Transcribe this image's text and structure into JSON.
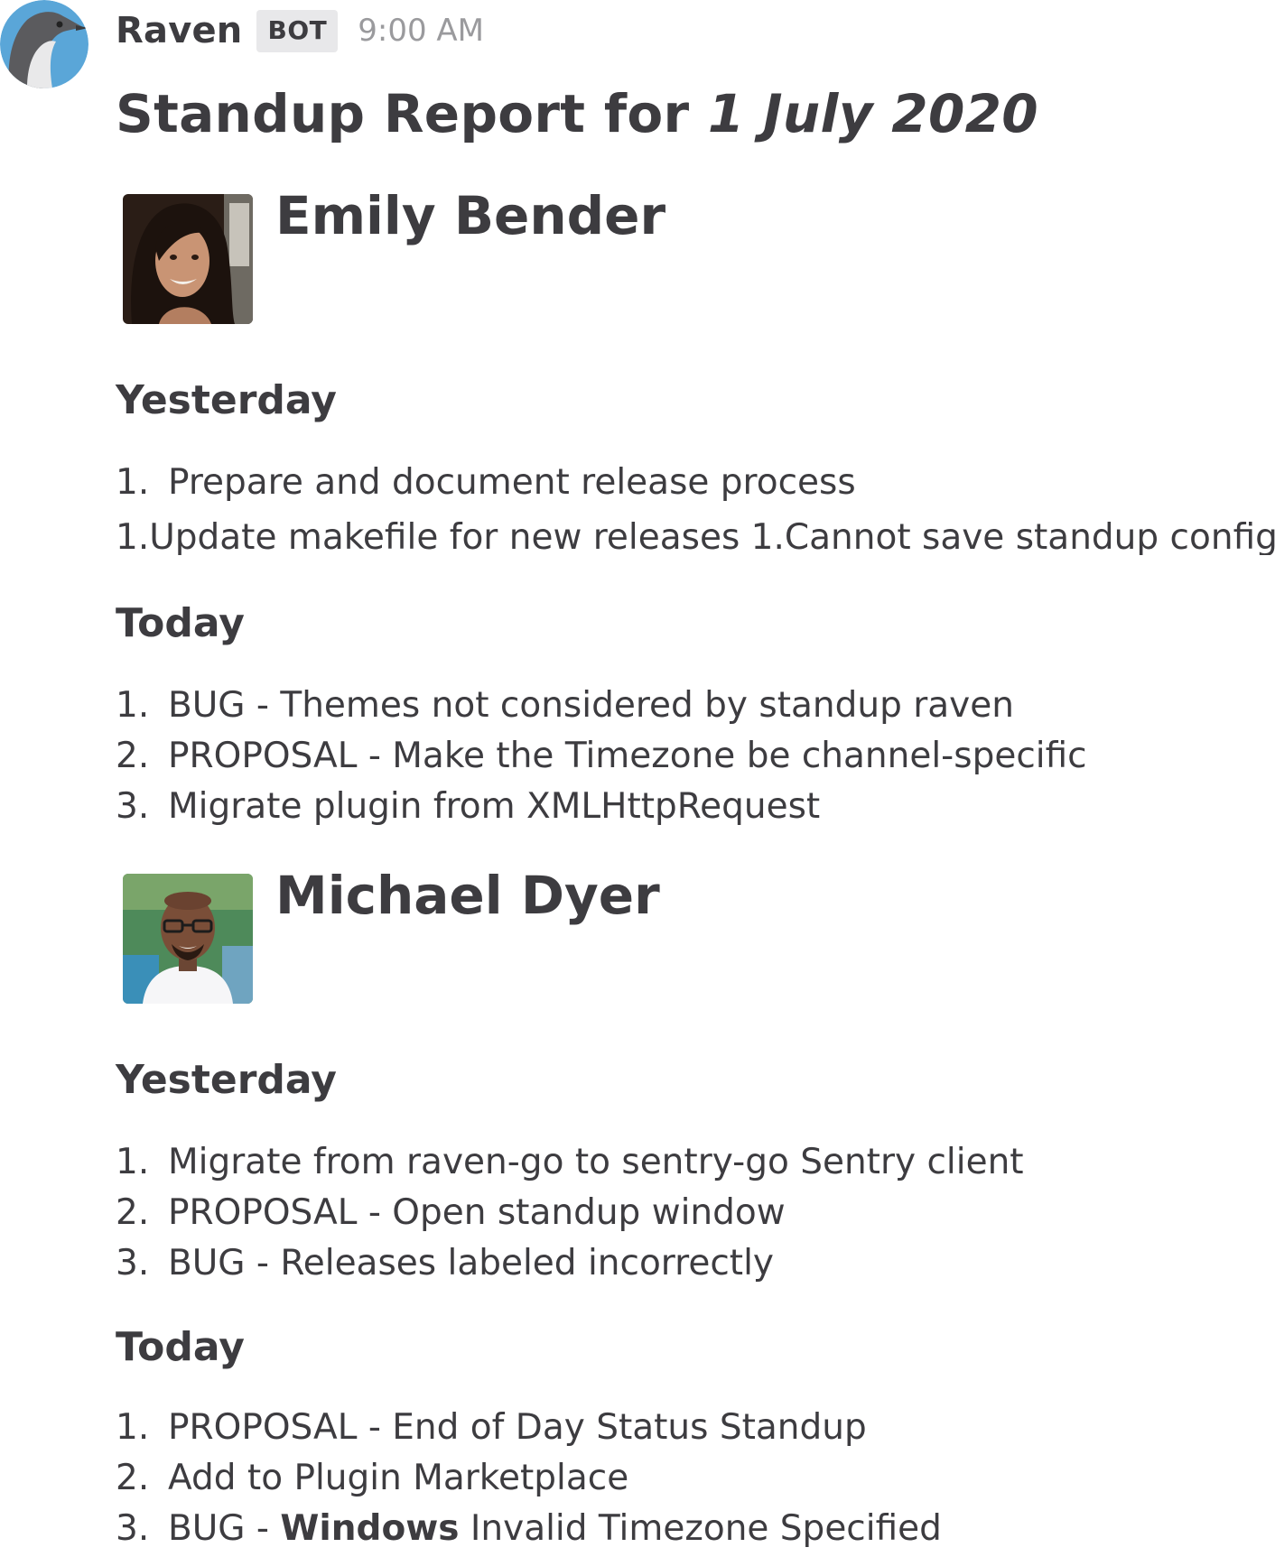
{
  "message": {
    "username": "Raven",
    "badge": "BOT",
    "time": "9:00 AM",
    "avatar_icon": "raven-bird-icon"
  },
  "report": {
    "title_prefix": "Standup Report for ",
    "title_date": "1 July 2020"
  },
  "members": [
    {
      "name": "Emily Bender",
      "avatar_icon": "user-photo-emily",
      "yesterday_heading": "Yesterday",
      "yesterday": [
        {
          "num": "1.",
          "text": "Prepare and document release process"
        }
      ],
      "yesterday_raw_line": "1.Update makefile for new releases 1.Cannot save standup config",
      "today_heading": "Today",
      "today": [
        {
          "num": "1.",
          "text": "BUG - Themes not considered by standup raven"
        },
        {
          "num": "2.",
          "text": "PROPOSAL - Make the Timezone be channel-specific"
        },
        {
          "num": "3.",
          "text": "Migrate plugin from XMLHttpRequest"
        }
      ]
    },
    {
      "name": "Michael Dyer",
      "avatar_icon": "user-photo-michael",
      "yesterday_heading": "Yesterday",
      "yesterday": [
        {
          "num": "1.",
          "text": "Migrate from raven-go to sentry-go Sentry client"
        },
        {
          "num": "2.",
          "text": "PROPOSAL - Open standup window"
        },
        {
          "num": "3.",
          "text": "BUG - Releases labeled incorrectly"
        }
      ],
      "today_heading": "Today",
      "today": [
        {
          "num": "1.",
          "text": "PROPOSAL - End of Day Status Standup"
        },
        {
          "num": "2.",
          "text": "Add to Plugin Marketplace"
        },
        {
          "num": "3.",
          "prefix": "BUG - ",
          "bold": "Windows",
          "suffix": " Invalid Timezone Specified"
        }
      ]
    }
  ]
}
